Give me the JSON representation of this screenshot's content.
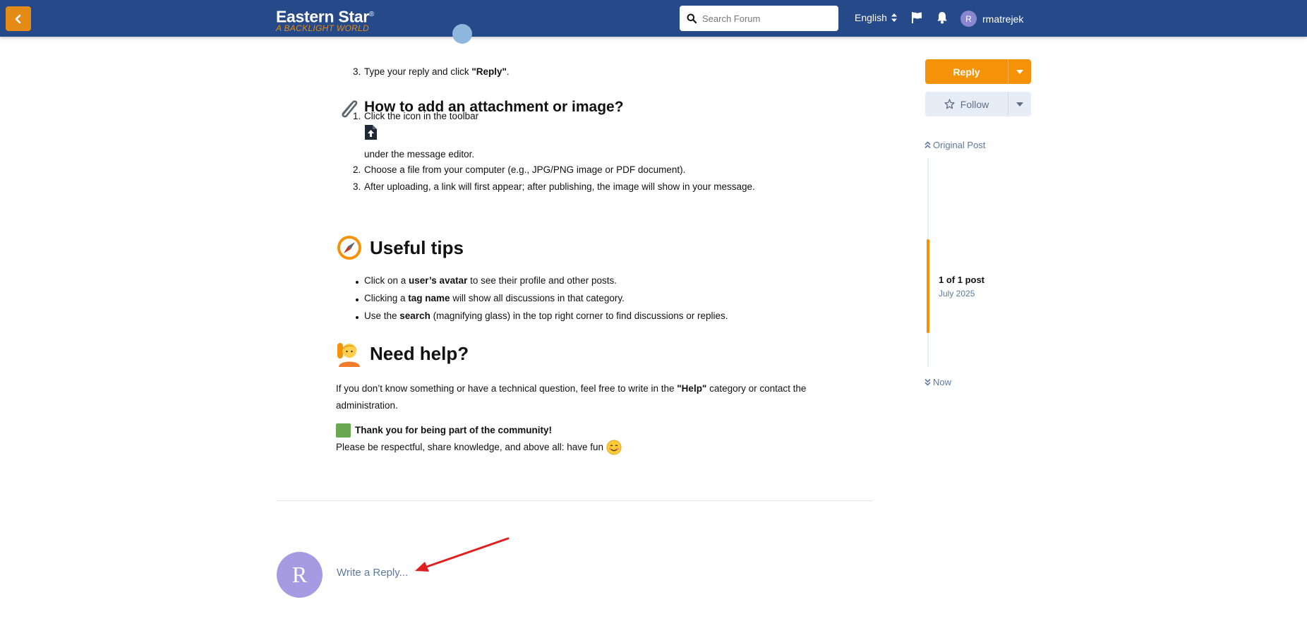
{
  "header": {
    "logo_main": "Eastern Star",
    "logo_mark": "®",
    "logo_sub": "A BACKLIGHT WORLD",
    "search_placeholder": "Search Forum",
    "language": "English",
    "username": "rmatrejek",
    "user_initial": "R"
  },
  "post": {
    "step3_num": "3.",
    "step3_pre": "Type your reply and click ",
    "step3_bold": "\"Reply\"",
    "step3_post": ".",
    "attach_heading": "How to add an attachment or image?",
    "attach_steps": [
      {
        "num": "1.",
        "text": "Click the icon in the toolbar"
      },
      {
        "num": "",
        "text": "under the message editor."
      },
      {
        "num": "2.",
        "text": "Choose a file from your computer (e.g., JPG/PNG image or PDF document)."
      },
      {
        "num": "3.",
        "text": "After uploading, a link will first appear; after publishing, the image will show in your message."
      }
    ],
    "tips_heading": "Useful tips",
    "tips": [
      {
        "pre": "Click on a ",
        "bold": "user’s avatar",
        "post": " to see their profile and other posts."
      },
      {
        "pre": "Clicking a ",
        "bold": "tag name",
        "post": " will show all discussions in that category."
      },
      {
        "pre": "Use the ",
        "bold": "search",
        "post": " (magnifying glass) in the top right corner to find discussions or replies."
      }
    ],
    "help_heading": "Need help?",
    "help_pre": "If you don’t know something or have a technical question, feel free to write in the ",
    "help_bold": "\"Help\"",
    "help_post": " category or contact the administration.",
    "thanks": "Thank you for being part of the community!",
    "closing": "Please be respectful, share knowledge, and above all: have fun"
  },
  "reply": {
    "avatar_initial": "R",
    "placeholder": "Write a Reply..."
  },
  "sidebar": {
    "reply_label": "Reply",
    "follow_label": "Follow",
    "original_post": "Original Post",
    "position_count": "1 of 1 post",
    "position_date": "July 2025",
    "now_label": "Now"
  },
  "colors": {
    "header_bg": "#26498a",
    "accent": "#f59207",
    "link": "#5b7aa0"
  }
}
